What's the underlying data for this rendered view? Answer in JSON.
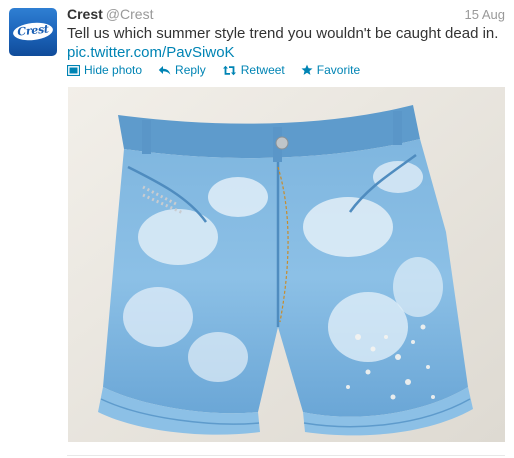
{
  "tweet": {
    "author_name": "Crest",
    "author_handle": "@Crest",
    "avatar_logo_text": "Crest",
    "timestamp": "15 Aug",
    "text": "Tell us which summer style trend you wouldn't be caught dead in.",
    "link": "pic.twitter.com/PavSiwoK",
    "actions": {
      "hide_photo": "Hide photo",
      "reply": "Reply",
      "retweet": "Retweet",
      "favorite": "Favorite"
    },
    "photo_subject": "bleached-denim-shorts"
  },
  "colors": {
    "link": "#0084b4",
    "muted": "#999999",
    "text": "#333333",
    "avatar_bg": "#1b62b8"
  },
  "icons": [
    "photo-icon",
    "reply-icon",
    "retweet-icon",
    "favorite-icon"
  ]
}
